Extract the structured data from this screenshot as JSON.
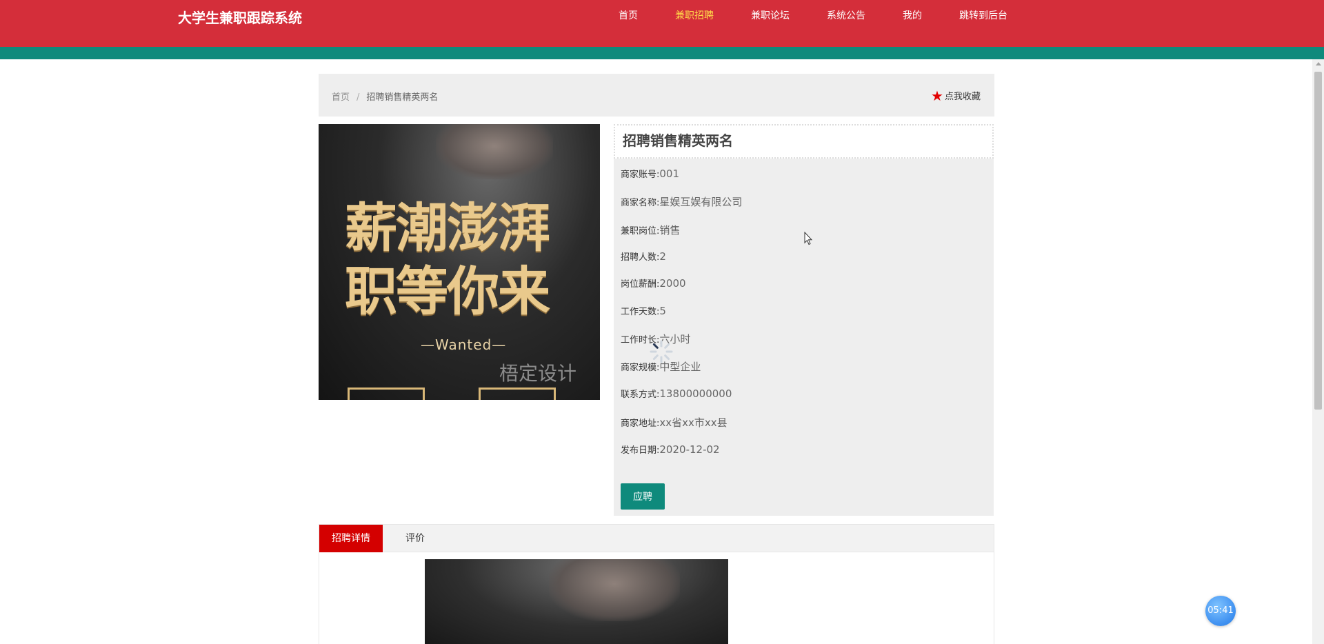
{
  "header": {
    "site_title": "大学生兼职跟踪系统",
    "nav": [
      {
        "label": "首页",
        "active": false
      },
      {
        "label": "兼职招聘",
        "active": true
      },
      {
        "label": "兼职论坛",
        "active": false
      },
      {
        "label": "系统公告",
        "active": false
      },
      {
        "label": "我的",
        "active": false
      },
      {
        "label": "跳转到后台",
        "active": false
      }
    ],
    "colors": {
      "bar": "#d42e3a",
      "stripe": "#0f8a7c",
      "active_nav": "#ffd94a"
    }
  },
  "breadcrumb": {
    "home": "首页",
    "separator": "/",
    "current": "招聘销售精英两名",
    "favorite_label": "点我收藏"
  },
  "poster": {
    "headline_line1": "薪潮澎湃",
    "headline_line2": "职等你来",
    "wanted": "—Wanted—",
    "brand": "梧定设计"
  },
  "job": {
    "title": "招聘销售精英两名",
    "fields": [
      {
        "label": "商家账号:",
        "value": "001"
      },
      {
        "label": "商家名称:",
        "value": "星娱互娱有限公司"
      },
      {
        "label": "兼职岗位:",
        "value": "销售"
      },
      {
        "label": "招聘人数:",
        "value": "2"
      },
      {
        "label": "岗位薪酬:",
        "value": "2000"
      },
      {
        "label": "工作天数:",
        "value": "5"
      },
      {
        "label": "工作时长:",
        "value": "六小时"
      },
      {
        "label": "商家规模:",
        "value": "中型企业"
      },
      {
        "label": "联系方式:",
        "value": "13800000000"
      },
      {
        "label": "商家地址:",
        "value": "xx省xx市xx县"
      },
      {
        "label": "发布日期:",
        "value": "2020-12-02"
      }
    ],
    "apply_label": "应聘"
  },
  "tabs": [
    {
      "label": "招聘详情",
      "active": true
    },
    {
      "label": "评价",
      "active": false
    }
  ],
  "timer": "05:41"
}
